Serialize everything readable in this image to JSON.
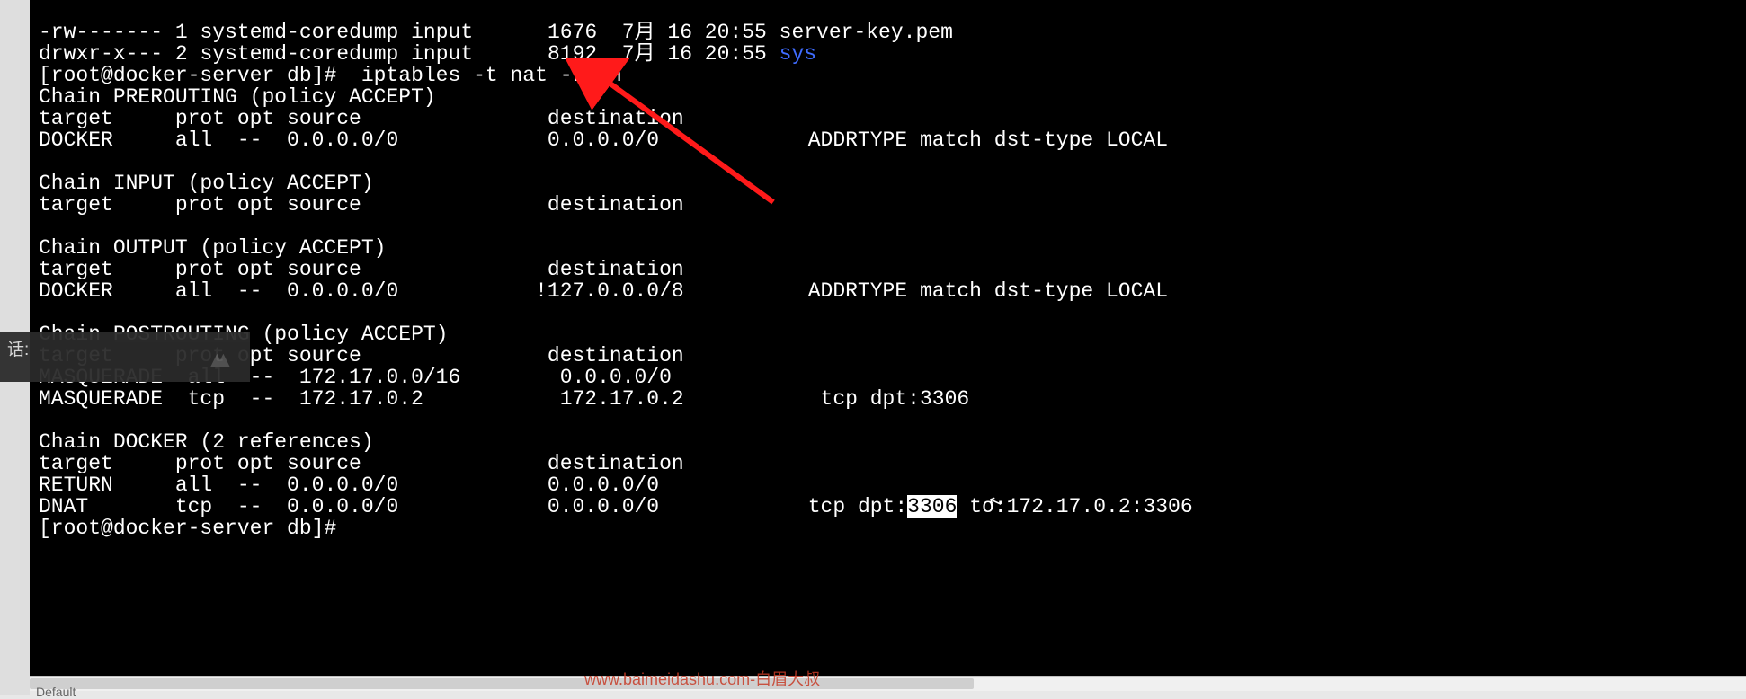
{
  "ls_lines": [
    {
      "perm": "-rw-------",
      "n": "1",
      "owner": "systemd-coredump",
      "group": "input",
      "size": "1676",
      "date": "7月 16 20:55",
      "name": "server-key.pem",
      "color": "white"
    },
    {
      "perm": "drwxr-x---",
      "n": "2",
      "owner": "systemd-coredump",
      "group": "input",
      "size": "8192",
      "date": "7月 16 20:55",
      "name": "sys",
      "color": "blue"
    }
  ],
  "prompt1": "[root@docker-server db]#  iptables -t nat -L -n",
  "chains": {
    "prerouting": {
      "header": "Chain PREROUTING (policy ACCEPT)",
      "cols": "target     prot opt source               destination",
      "rows": [
        "DOCKER     all  --  0.0.0.0/0            0.0.0.0/0            ADDRTYPE match dst-type LOCAL"
      ]
    },
    "input": {
      "header": "Chain INPUT (policy ACCEPT)",
      "cols": "target     prot opt source               destination",
      "rows": []
    },
    "output": {
      "header": "Chain OUTPUT (policy ACCEPT)",
      "cols": "target     prot opt source               destination",
      "rows": [
        "DOCKER     all  --  0.0.0.0/0           !127.0.0.0/8          ADDRTYPE match dst-type LOCAL"
      ]
    },
    "postrouting": {
      "header": "Chain POSTROUTING (policy ACCEPT)",
      "cols": "target     prot opt source               destination",
      "rows": [
        "MASQUERADE  all  --  172.17.0.0/16        0.0.0.0/0",
        "MASQUERADE  tcp  --  172.17.0.2           172.17.0.2           tcp dpt:3306"
      ]
    },
    "docker": {
      "header": "Chain DOCKER (2 references)",
      "cols": "target     prot opt source               destination",
      "rows": [
        "RETURN     all  --  0.0.0.0/0            0.0.0.0/0",
        {
          "pre": "DNAT       tcp  --  0.0.0.0/0            0.0.0.0/0            tcp dpt:",
          "hl": "3306",
          "post": " to:172.17.0.2:3306"
        }
      ]
    }
  },
  "prompt2": "[root@docker-server db]# ",
  "overlay_label": "话:",
  "watermark": "www.baimeidashu.com-白眉大叔",
  "tab_hint": "Default"
}
